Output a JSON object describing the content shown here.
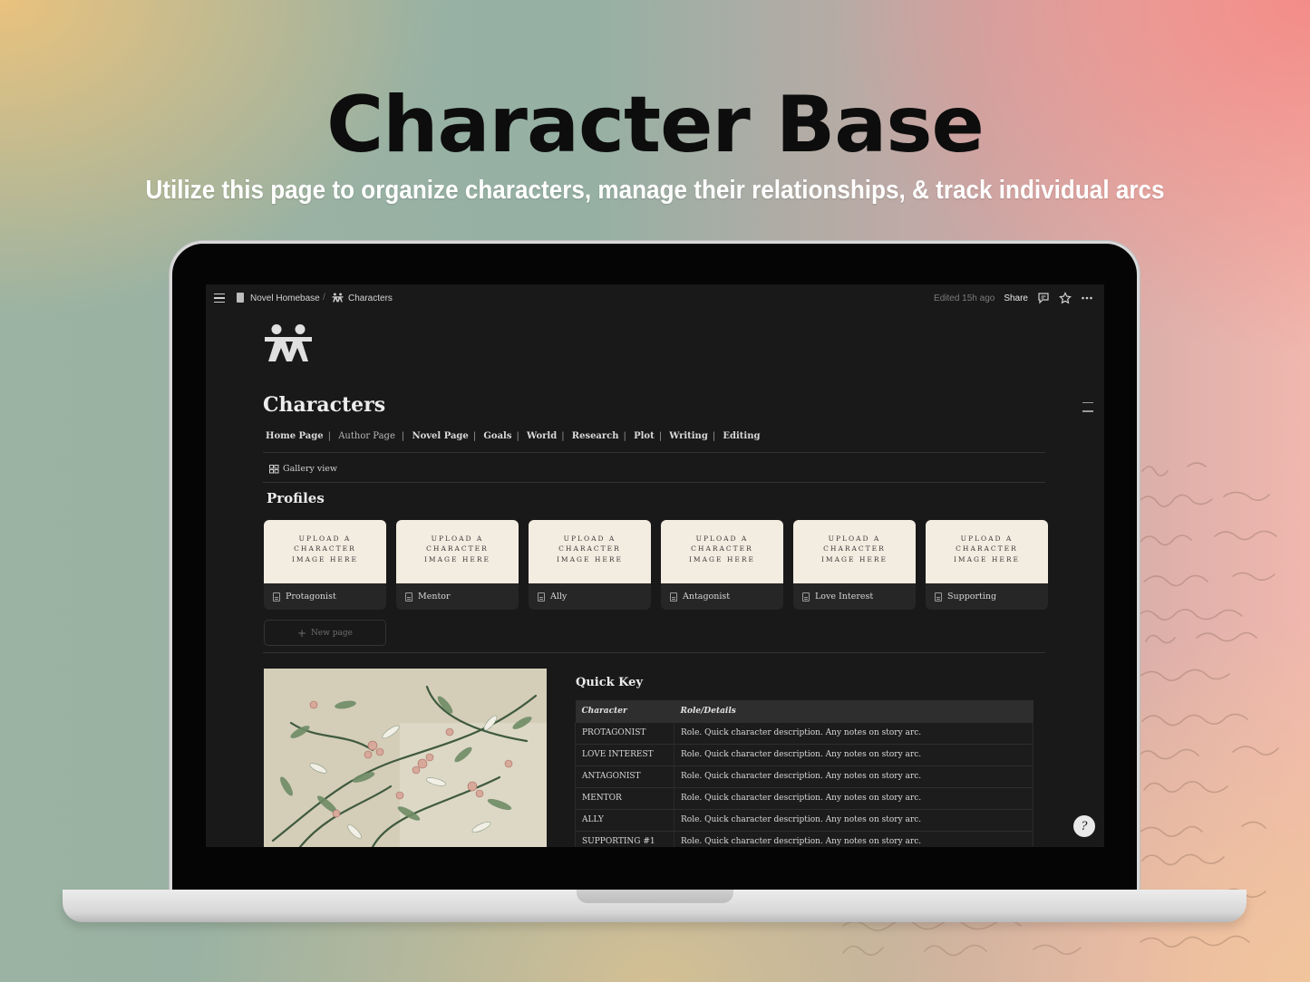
{
  "hero": {
    "title": "Character Base",
    "subtitle": "Utilize this page to organize characters, manage their relationships, & track individual arcs"
  },
  "topbar": {
    "breadcrumb": [
      "Novel Homebase",
      "/",
      "Characters"
    ],
    "edited": "Edited 15h ago",
    "share": "Share",
    "icons": [
      "menu-icon",
      "comment-icon",
      "star-icon",
      "more-icon"
    ]
  },
  "page": {
    "title": "Characters",
    "nav_links": [
      {
        "label": "Home Page"
      },
      {
        "label": "Author Page"
      },
      {
        "label": "Novel Page"
      },
      {
        "label": "Goals"
      },
      {
        "label": "World"
      },
      {
        "label": "Research"
      },
      {
        "label": "Plot"
      },
      {
        "label": "Writing"
      },
      {
        "label": "Editing"
      }
    ],
    "view_tab": "Gallery view",
    "profiles_heading": "Profiles",
    "card_placeholder_lines": [
      "UPLOAD A",
      "CHARACTER",
      "IMAGE HERE"
    ],
    "cards": [
      "Protagonist",
      "Mentor",
      "Ally",
      "Antagonist",
      "Love Interest",
      "Supporting"
    ],
    "new_page": "New page",
    "quick_key": {
      "heading": "Quick Key",
      "columns": [
        "Character",
        "Role/Details"
      ],
      "rows": [
        [
          "PROTAGONIST",
          "Role. Quick character description. Any notes on story arc."
        ],
        [
          "LOVE INTEREST",
          "Role. Quick character description. Any notes on story arc."
        ],
        [
          "ANTAGONIST",
          "Role. Quick character description. Any notes on story arc."
        ],
        [
          "MENTOR",
          "Role. Quick character description. Any notes on story arc."
        ],
        [
          "ALLY",
          "Role. Quick character description. Any notes on story arc."
        ],
        [
          "SUPPORTING #1",
          "Role. Quick character description. Any notes on story arc."
        ]
      ]
    }
  },
  "colors": {
    "notion_bg": "#191919",
    "card_image_bg": "#f3ece0",
    "hero_title": "#0d0d0d",
    "hero_subtitle": "#ffffff"
  }
}
